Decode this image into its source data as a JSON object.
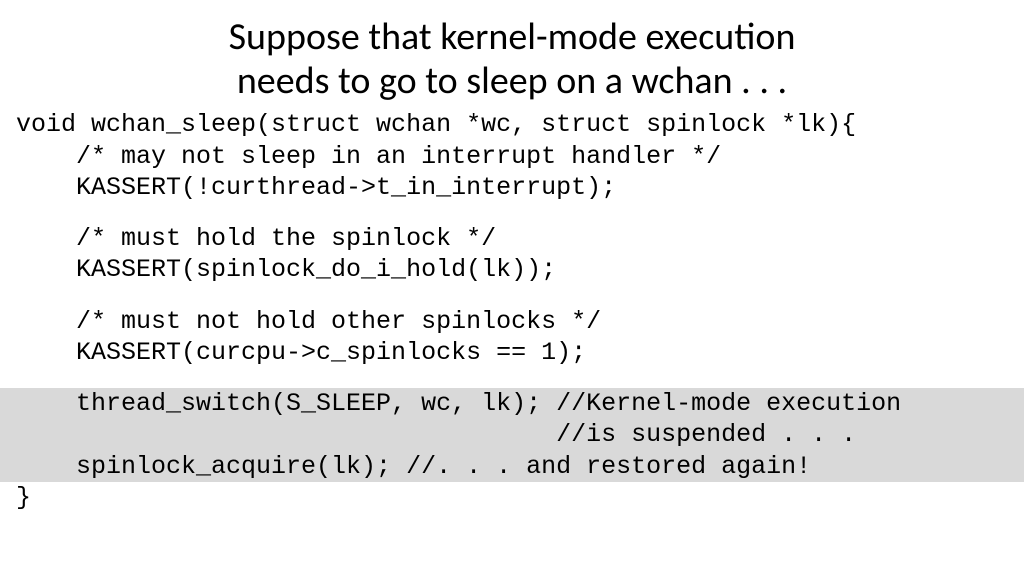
{
  "title_line1": "Suppose that kernel-mode execution",
  "title_line2": "needs to go to sleep on a wchan . . .",
  "code": {
    "line01": "void wchan_sleep(struct wchan *wc, struct spinlock *lk){",
    "line02": "    /* may not sleep in an interrupt handler */",
    "line03": "    KASSERT(!curthread->t_in_interrupt);",
    "line04": "    /* must hold the spinlock */",
    "line05": "    KASSERT(spinlock_do_i_hold(lk));",
    "line06": "    /* must not hold other spinlocks */",
    "line07": "    KASSERT(curcpu->c_spinlocks == 1);",
    "line08": "    thread_switch(S_SLEEP, wc, lk); //Kernel-mode execution",
    "line09": "                                    //is suspended . . .",
    "line10": "    spinlock_acquire(lk); //. . . and restored again!",
    "line11": "}"
  }
}
